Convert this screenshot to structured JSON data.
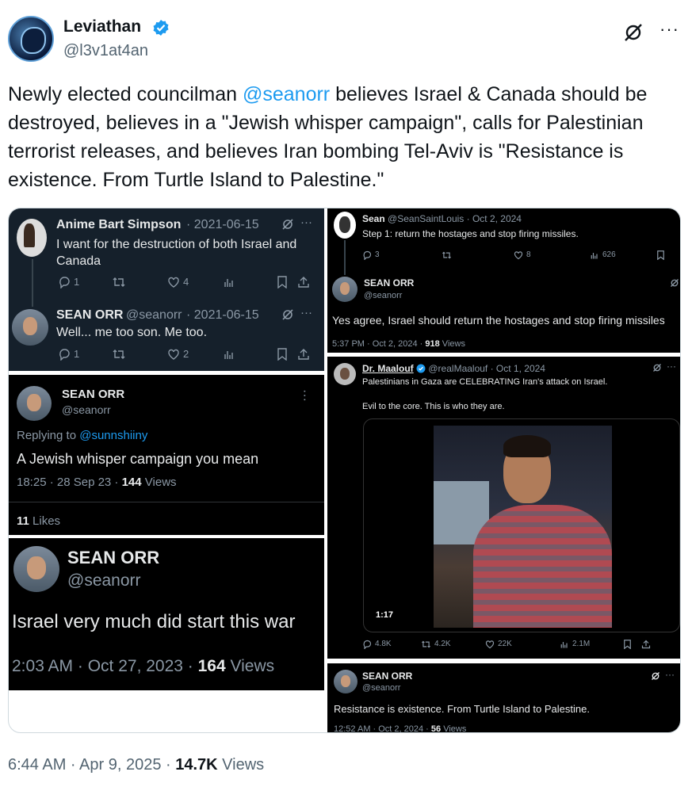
{
  "author": {
    "name": "Leviathan",
    "handle": "@l3v1at4an",
    "verified": true
  },
  "icons": {
    "verified": "verified-badge-icon",
    "grok": "grok-icon",
    "more": "more-icon"
  },
  "more_glyph": "···",
  "tweet": {
    "part1": "Newly elected councilman ",
    "mention": "@seanorr",
    "part2": " believes Israel & Canada should be destroyed, believes in a \"Jewish whisper campaign\", calls for Palestinian terrorist releases, and believes Iran bombing Tel-Aviv is \"Resistance is existence. From Turtle Island to Palestine.\""
  },
  "panel1": {
    "first": {
      "name": "Anime Bart Simpson",
      "date": "· 2021-06-15",
      "text": "I want for the destruction of both Israel and Canada",
      "replies": "1",
      "likes": "4"
    },
    "second": {
      "name": "SEAN ORR",
      "handle": "@seanorr",
      "date": "· 2021-06-15",
      "text": "Well... me too son. Me too.",
      "replies": "1",
      "likes": "2"
    }
  },
  "panel2": {
    "name": "SEAN ORR",
    "handle": "@seanorr",
    "replying_prefix": "Replying to ",
    "replying_to": "@sunnshiiny",
    "text": "A Jewish whisper campaign you mean",
    "meta_prefix": "18:25 · 28 Sep 23 · ",
    "views": "144",
    "views_label": " Views",
    "likes_count": "11",
    "likes_label": " Likes"
  },
  "panel3": {
    "name": "SEAN ORR",
    "handle": "@seanorr",
    "text": "Israel very much did start this war",
    "meta_prefix": "2:03 AM · Oct 27, 2023 · ",
    "views": "164",
    "views_label": " Views"
  },
  "panel4": {
    "top": {
      "name": "Sean",
      "handle_date": "@SeanSaintLouis · Oct 2, 2024",
      "text": "Step 1: return the hostages and stop firing missiles.",
      "replies": "3",
      "likes": "8",
      "views": "626"
    },
    "reply": {
      "name": "SEAN ORR",
      "handle": "@seanorr",
      "text": "Yes agree, Israel should return the hostages and stop firing missiles",
      "meta_prefix": "5:37 PM · Oct 2, 2024 · ",
      "views": "918",
      "views_label": " Views"
    }
  },
  "panel5": {
    "top": {
      "name": "Dr. Maalouf",
      "handle_date": "@realMaalouf · Oct 1, 2024",
      "text1": "Palestinians in Gaza are CELEBRATING Iran's attack on Israel.",
      "text2": "Evil to the core. This is who they are.",
      "video_time": "1:17",
      "replies": "4.8K",
      "retweets": "4.2K",
      "likes": "22K",
      "views": "2.1M"
    },
    "reply": {
      "name": "SEAN ORR",
      "handle": "@seanorr",
      "text": "Resistance is existence. From Turtle Island to Palestine.",
      "meta_prefix": "12:52 AM · Oct 2, 2024 · ",
      "views": "56",
      "views_label": " Views"
    }
  },
  "footer": {
    "time": "6:44 AM · Apr 9, 2025 · ",
    "views": "14.7K",
    "views_label": " Views"
  }
}
